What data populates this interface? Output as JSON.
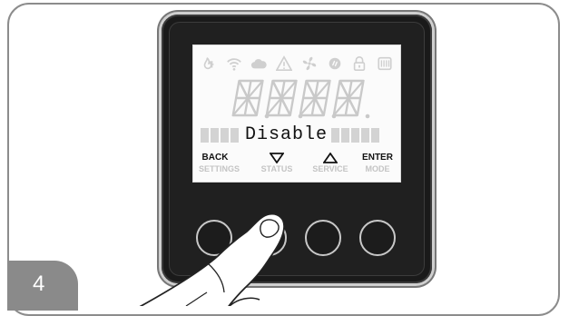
{
  "step": {
    "number": "4"
  },
  "display": {
    "segment_text": "8.8.8.8.",
    "message": "Disable",
    "icons": [
      "flame-icon",
      "wifi-icon",
      "cloud-icon",
      "warning-icon",
      "fan-icon",
      "heating-icon",
      "lock-icon",
      "heater-icon"
    ]
  },
  "buttons": [
    {
      "top_label": "BACK",
      "bottom_label": "SETTINGS"
    },
    {
      "top_label": "",
      "bottom_label": "STATUS",
      "arrow": "down"
    },
    {
      "top_label": "",
      "bottom_label": "SERVICE",
      "arrow": "up"
    },
    {
      "top_label": "ENTER",
      "bottom_label": "MODE"
    }
  ],
  "colors": {
    "frame": "#8c8c8c",
    "device": "#1a1a1a",
    "lcd_bg": "#fbfbfb",
    "badge": "#8a8a8a"
  }
}
